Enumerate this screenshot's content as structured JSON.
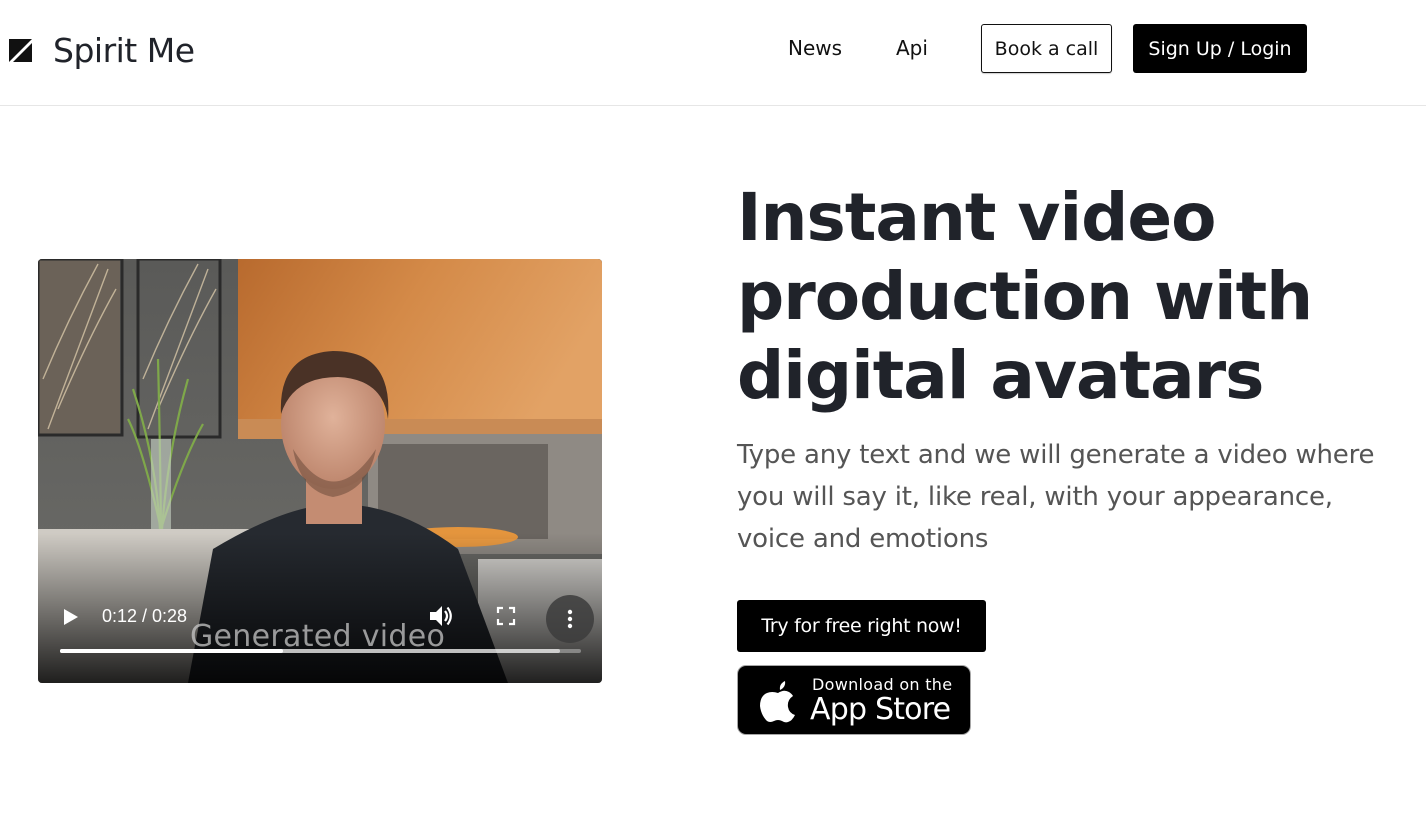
{
  "header": {
    "brand": "Spirit Me",
    "nav": [
      {
        "label": "News"
      },
      {
        "label": "Api"
      }
    ],
    "book_call_label": "Book a call",
    "signup_label": "Sign Up / Login"
  },
  "video": {
    "time_display": "0:12 / 0:28",
    "watermark": "Generated video",
    "progress_fraction": 0.4286,
    "buffered_fraction": 0.96,
    "icons": {
      "play": "play-icon",
      "volume": "volume-icon",
      "fullscreen": "fullscreen-icon",
      "more": "more-vertical-icon"
    }
  },
  "hero": {
    "title": "Instant video production with digital avatars",
    "subtitle": "Type any text and we will generate a video where you will say it, like real, with your appearance, voice and emotions",
    "cta_label": "Try for free right now!",
    "appstore": {
      "small_text": "Download on the",
      "big_text": "App Store",
      "icon": "apple-icon"
    }
  },
  "colors": {
    "text_dark": "#20232a",
    "text_muted": "#555555",
    "button_dark": "#000000",
    "divider": "#e6e6e6"
  }
}
